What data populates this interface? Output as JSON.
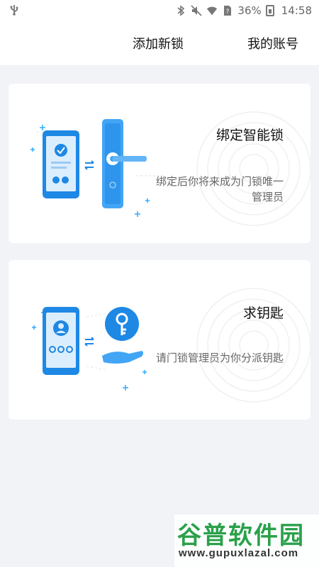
{
  "status_bar": {
    "battery_percent": "36%",
    "time": "14:58",
    "icons": [
      "usb-icon",
      "bluetooth-icon",
      "mute-icon",
      "wifi-icon",
      "sim-unknown-icon",
      "battery-icon"
    ]
  },
  "tabs": {
    "add_lock": "添加新锁",
    "my_account": "我的账号"
  },
  "cards": [
    {
      "title": "绑定智能锁",
      "description": "绑定后你将来成为门锁唯一管理员",
      "illustration": "phone-and-door-lock"
    },
    {
      "title": "求钥匙",
      "description": "请门锁管理员为你分派钥匙",
      "illustration": "phone-and-key"
    }
  ],
  "watermark": {
    "brand": "谷普软件园",
    "url": "www.gupuxlazal.com"
  },
  "colors": {
    "accent": "#1e88e5",
    "accent_light": "#42a5f5",
    "background": "#f2f3f6"
  }
}
